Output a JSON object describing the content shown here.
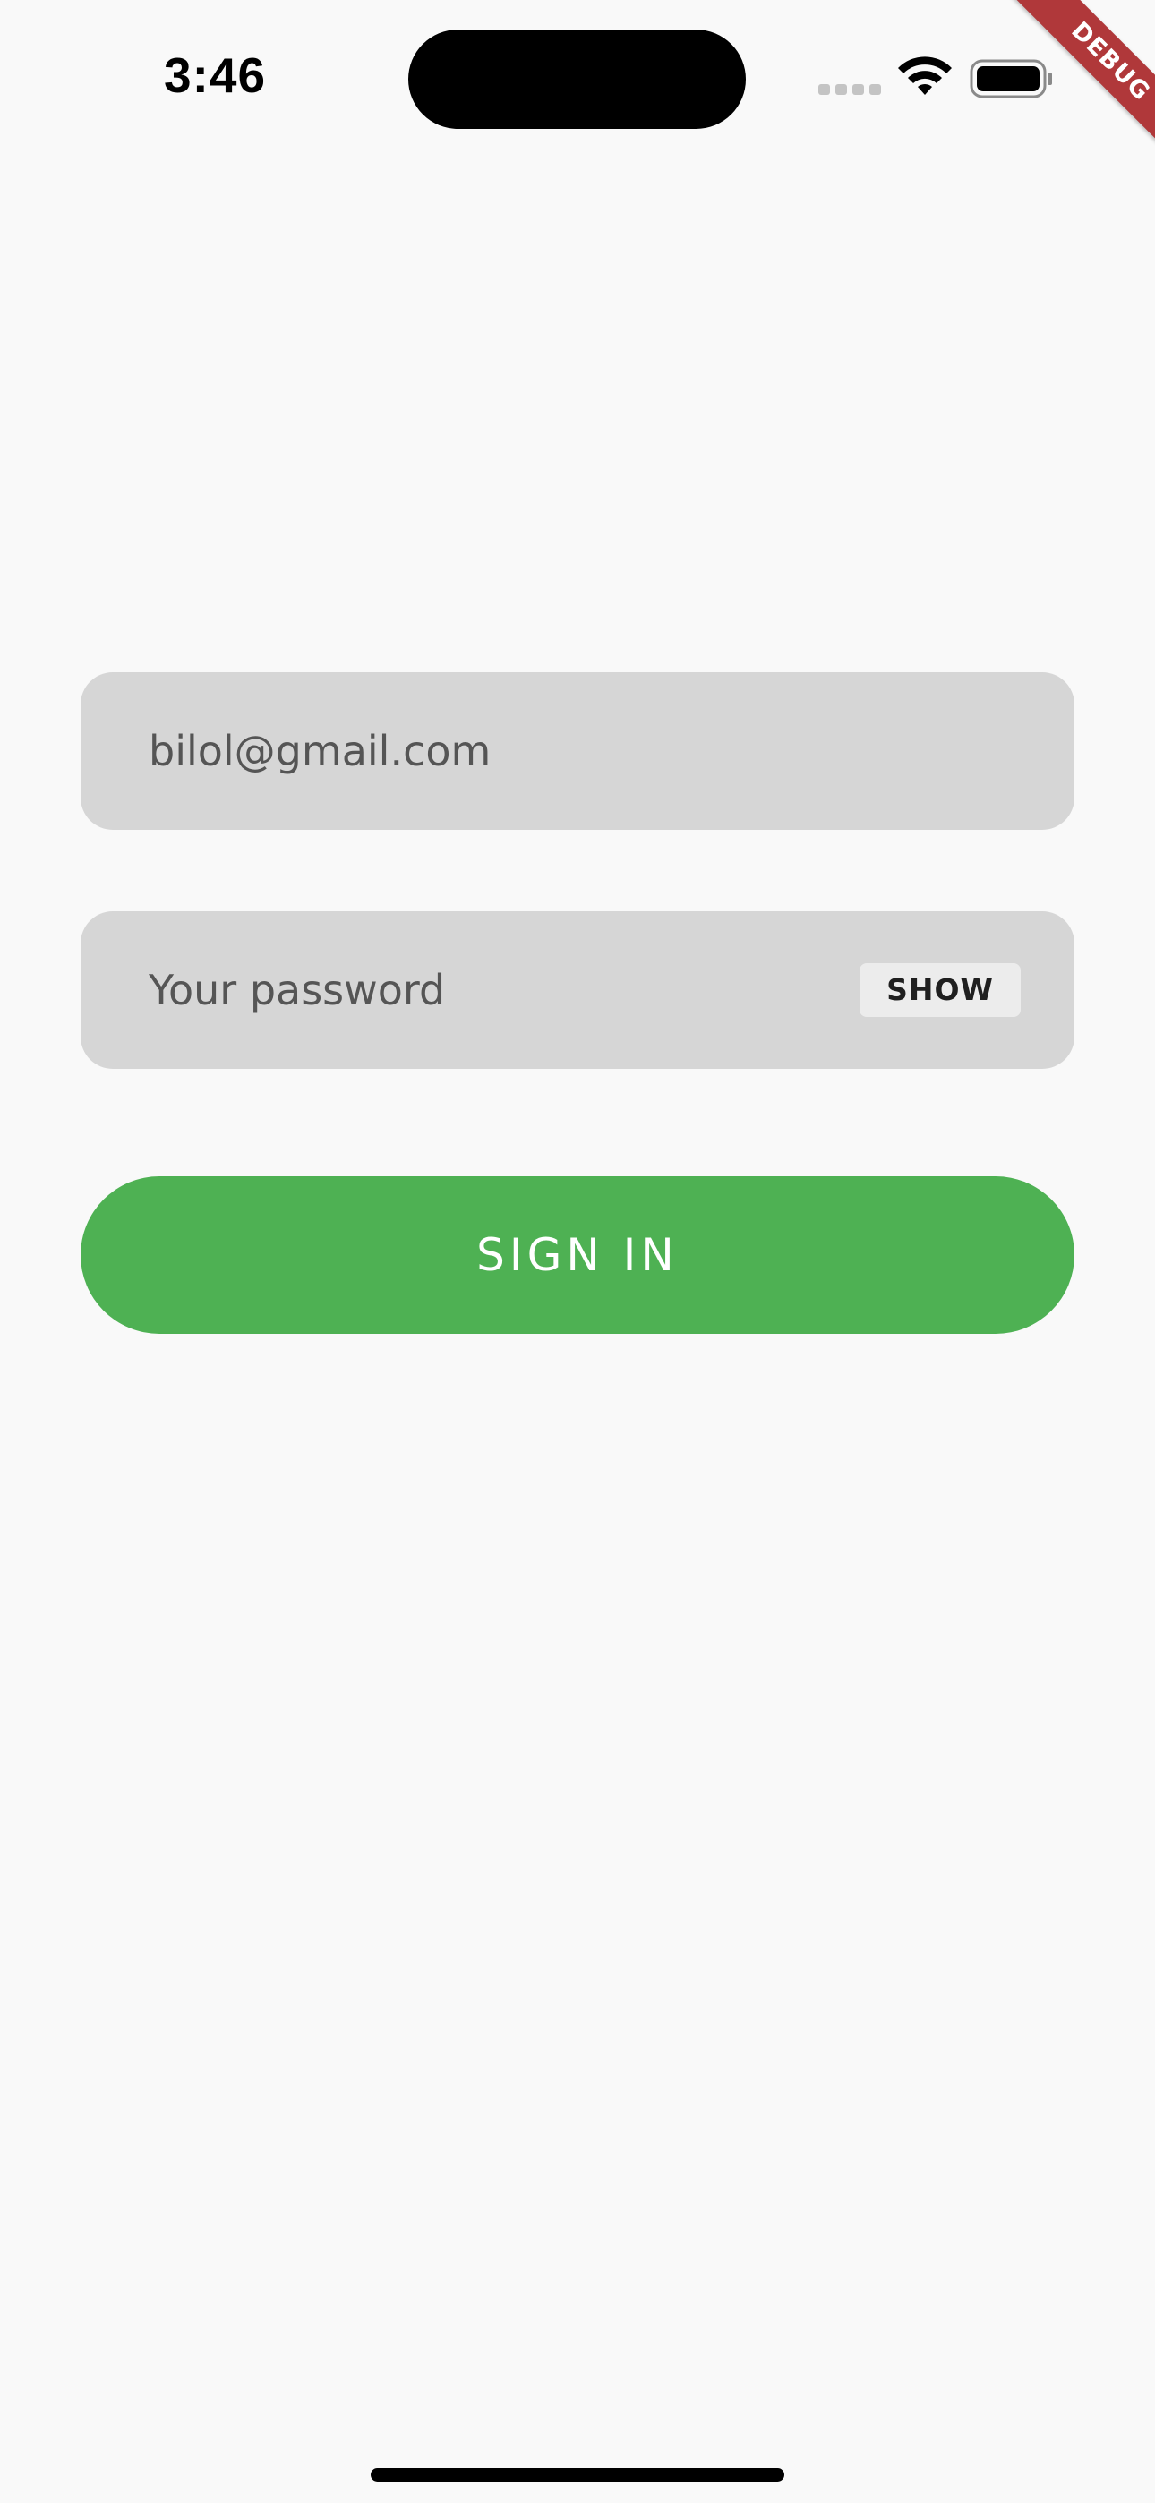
{
  "status_bar": {
    "time": "3:46",
    "icons": [
      "signal-icon",
      "wifi-icon",
      "battery-icon"
    ]
  },
  "debug_banner": {
    "label": "DEBUG",
    "color": "#b0383a"
  },
  "form": {
    "email_value": "bilol@gmail.com",
    "password_placeholder": "Your password",
    "show_label": "SHOW",
    "sign_in_label": "SIGN IN"
  },
  "colors": {
    "background": "#f9f9f9",
    "field_fill": "#d6d6d6",
    "primary_button": "#4eb153"
  }
}
